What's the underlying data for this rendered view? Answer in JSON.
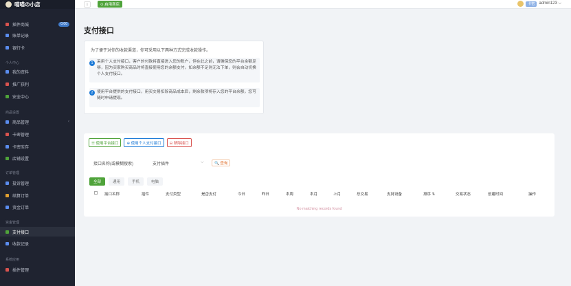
{
  "sidebar": {
    "brand": "喵喵の小店",
    "items": [
      {
        "label": "插件商城",
        "badge": "0.00",
        "color": "#d9534f"
      },
      {
        "label": "账单记录",
        "color": "#5b8def"
      },
      {
        "label": "银行卡",
        "color": "#5b8def"
      },
      {
        "label": "我的资料",
        "color": "#5b8def"
      },
      {
        "label": "推广获利",
        "color": "#d9534f"
      },
      {
        "label": "安全中心",
        "color": "#4fa33a"
      },
      {
        "label": "商品管理",
        "color": "#5b8def",
        "arrow": "‹"
      },
      {
        "label": "卡密管理",
        "color": "#d9534f"
      },
      {
        "label": "卡密库存",
        "color": "#5b8def"
      },
      {
        "label": "店铺设置",
        "color": "#4fa33a"
      },
      {
        "label": "投诉管理",
        "color": "#5b8def"
      },
      {
        "label": "结算订单",
        "color": "#e0a030"
      },
      {
        "label": "资金订单",
        "color": "#5b8def"
      },
      {
        "label": "支付接口",
        "color": "#4fa33a"
      },
      {
        "label": "收款记录",
        "color": "#5b8def"
      },
      {
        "label": "插件管理",
        "color": "#d9534f"
      }
    ],
    "groups": [
      "个人中心",
      "商品设置",
      "订单管理",
      "资金管理",
      "系统应用"
    ]
  },
  "topbar": {
    "menu": "⁝",
    "shop_btn": "⊙ 启用商店",
    "user_tag": "卡密",
    "username": "admin123 ⌵"
  },
  "page": {
    "title": "支付接口"
  },
  "info": {
    "intro": "为了便于对你的收款渠道，你可采用以下两种方式完成收款操作。",
    "opt1_num": "1",
    "opt1": "采用个人支付接口，客户的付款将直接进入您的账户，但在此之前，请确保您的平台余额足够，因为买家购买商品时将直接使用您的余额支付，如余额不足则无法下单，则会自动切换个人支付接口。",
    "opt2_num": "2",
    "opt2": "使用平台提供的支付接口，用买交易扣除商品成本后，剩余款项将存入您的平台余额，您可随时申请提现。"
  },
  "table": {
    "btn1": "☰ 使用平台接口",
    "btn2": "⊕ 使用个人支付接口",
    "btn3": "⊟ 移除接口",
    "filter1": "接口名称(或模糊搜索)",
    "filter2": "支付插件",
    "caret": "⌵",
    "search": "🔍 查询",
    "tabs": [
      "全部",
      "通用",
      "手机",
      "电脑"
    ],
    "headers": [
      "接口名称",
      "插件",
      "支付类型",
      "是否支付",
      "今日",
      "昨日",
      "本周",
      "本月",
      "上月",
      "总交易",
      "支持设备",
      "排序 ⇅",
      "交易状态",
      "创建时间",
      "操作"
    ],
    "empty": "No matching records found"
  }
}
